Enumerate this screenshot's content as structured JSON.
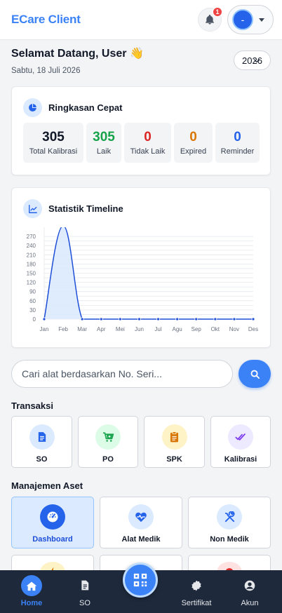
{
  "header": {
    "brand": "ECare Client",
    "notif_count": "1",
    "avatar_initial": "-"
  },
  "welcome": {
    "greeting": "Selamat Datang, User 👋",
    "date": "Sabtu, 18 Juli 2026",
    "year": "2026"
  },
  "summary": {
    "title": "Ringkasan Cepat",
    "stats": [
      {
        "value": "305",
        "label": "Total Kalibrasi",
        "color": "#111827"
      },
      {
        "value": "305",
        "label": "Laik",
        "color": "#16a34a"
      },
      {
        "value": "0",
        "label": "Tidak Laik",
        "color": "#dc2626"
      },
      {
        "value": "0",
        "label": "Expired",
        "color": "#d97706"
      },
      {
        "value": "0",
        "label": "Reminder",
        "color": "#2563eb"
      }
    ]
  },
  "timeline": {
    "title": "Statistik Timeline"
  },
  "chart_data": {
    "type": "area",
    "categories": [
      "Jan",
      "Feb",
      "Mar",
      "Apr",
      "Mei",
      "Jun",
      "Jul",
      "Agu",
      "Sep",
      "Okt",
      "Nov",
      "Des"
    ],
    "values": [
      0,
      305,
      0,
      0,
      0,
      0,
      0,
      0,
      0,
      0,
      0,
      0
    ],
    "yticks": [
      0,
      15,
      30,
      45,
      60,
      75,
      90,
      105,
      120,
      135,
      150,
      165,
      180,
      195,
      210,
      225,
      240,
      255,
      270
    ],
    "ytick_labels": [
      0,
      30,
      60,
      90,
      120,
      150,
      180,
      210,
      240,
      270
    ],
    "ylim": [
      0,
      300
    ],
    "grid": true,
    "line_color": "#1d4ed8",
    "fill_color": "#dbeafe"
  },
  "search": {
    "placeholder": "Cari alat berdasarkan No. Seri..."
  },
  "transaksi": {
    "title": "Transaksi",
    "items": [
      {
        "label": "SO",
        "icon": "document-icon",
        "bg": "#dbeafe",
        "fg": "#2563eb"
      },
      {
        "label": "PO",
        "icon": "cart-icon",
        "bg": "#dcfce7",
        "fg": "#16a34a"
      },
      {
        "label": "SPK",
        "icon": "clipboard-icon",
        "bg": "#fef3c7",
        "fg": "#d97706"
      },
      {
        "label": "Kalibrasi",
        "icon": "double-check-icon",
        "bg": "#ede9fe",
        "fg": "#7c3aed"
      }
    ]
  },
  "aset": {
    "title": "Manajemen Aset",
    "items": [
      {
        "label": "Dashboard",
        "icon": "gauge-icon"
      },
      {
        "label": "Alat Medik",
        "icon": "heart-pulse-icon"
      },
      {
        "label": "Non Medik",
        "icon": "tools-icon"
      }
    ]
  },
  "bottom_nav": {
    "home": "Home",
    "so": "SO",
    "sertifikat": "Sertifikat",
    "akun": "Akun"
  }
}
